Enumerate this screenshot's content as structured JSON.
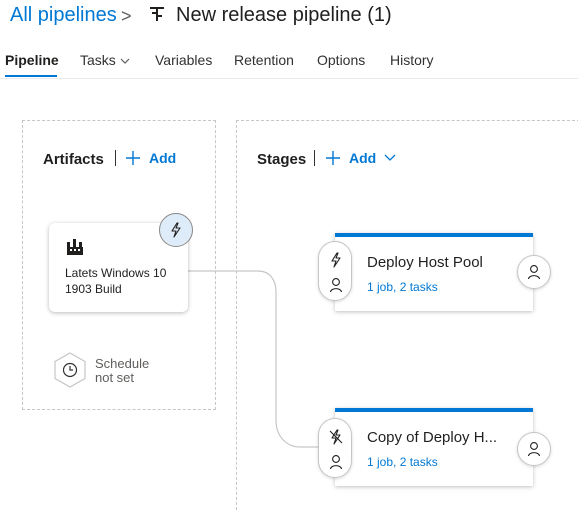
{
  "breadcrumb": {
    "root": "All pipelines",
    "separator": ">",
    "title": "New release pipeline (1)"
  },
  "tabs": [
    {
      "label": "Pipeline",
      "active": true
    },
    {
      "label": "Tasks",
      "has_dropdown": true
    },
    {
      "label": "Variables"
    },
    {
      "label": "Retention"
    },
    {
      "label": "Options"
    },
    {
      "label": "History"
    }
  ],
  "artifacts": {
    "title": "Artifacts",
    "add_label": "Add",
    "card": {
      "name": "Latets Windows 10 1903 Build",
      "icon": "build-icon",
      "trigger_icon": "lightning-icon"
    },
    "schedule": {
      "line1": "Schedule",
      "line2": "not set",
      "icon": "clock-icon"
    }
  },
  "stages": {
    "title": "Stages",
    "add_label": "Add",
    "items": [
      {
        "name": "Deploy Host Pool",
        "summary": "1 job, 2 tasks",
        "pre_icon": "lightning-icon"
      },
      {
        "name": "Copy of Deploy H...",
        "summary": "1 job, 2 tasks",
        "pre_icon": "lightning-off-icon"
      }
    ]
  },
  "colors": {
    "accent": "#0078d4",
    "badge_bg": "#deecf9",
    "text": "#201f1e",
    "muted": "#605e5c"
  }
}
